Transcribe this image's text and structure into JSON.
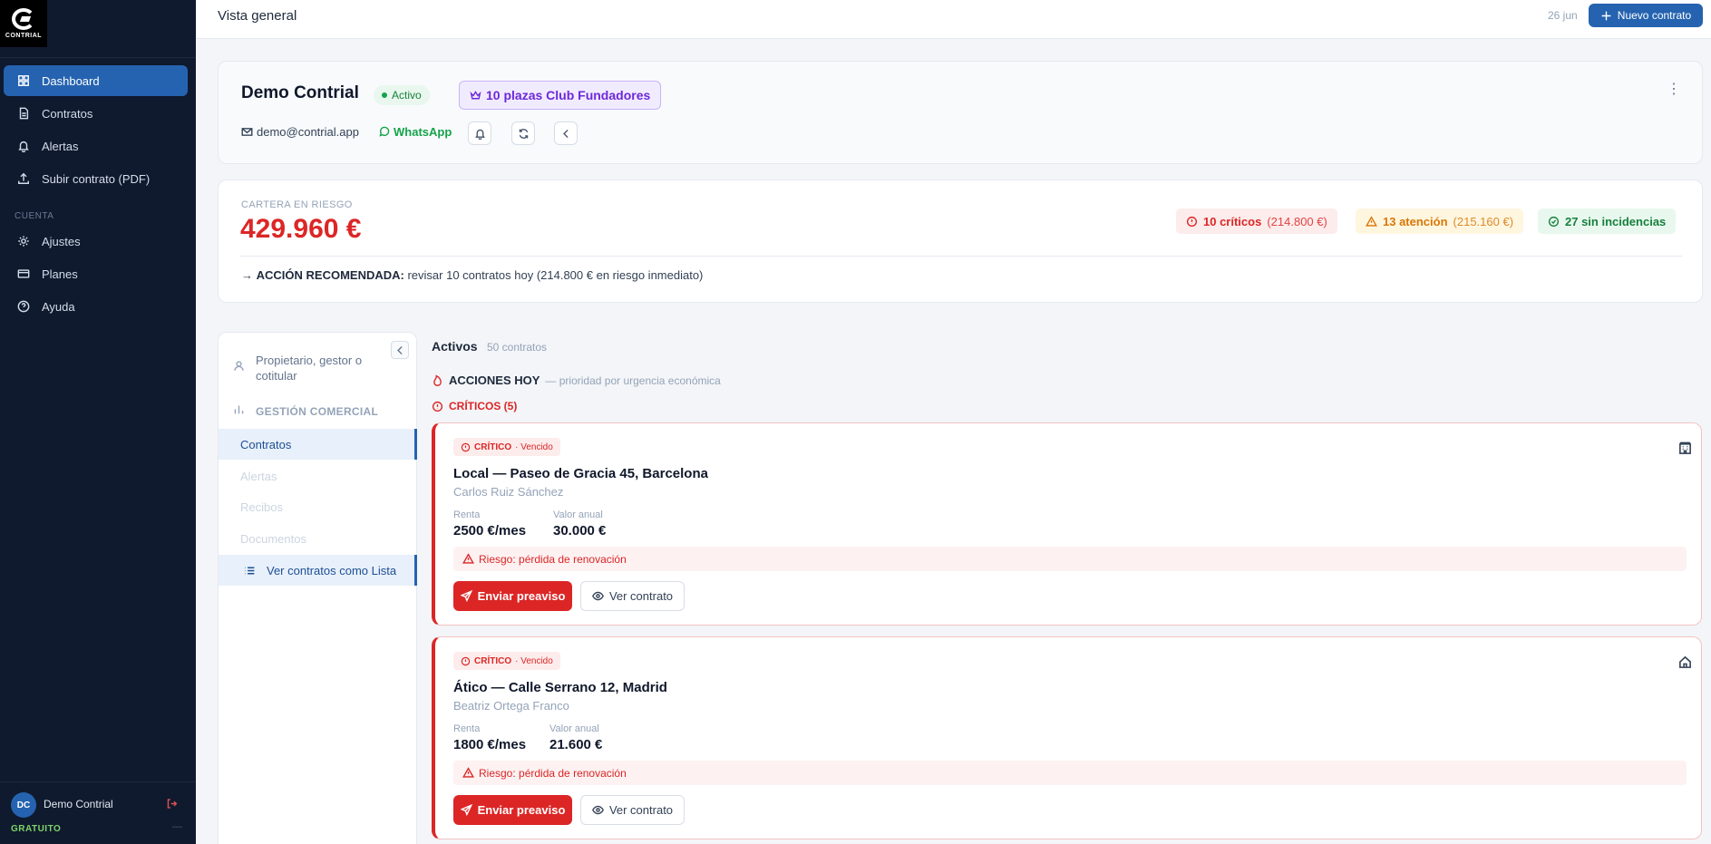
{
  "brand": {
    "logo_text": "CONTRIAL"
  },
  "sidebar": {
    "items": [
      {
        "label": "Dashboard",
        "icon": "grid-icon"
      },
      {
        "label": "Contratos",
        "icon": "document-icon"
      },
      {
        "label": "Alertas",
        "icon": "bell-icon"
      },
      {
        "label": "Subir contrato (PDF)",
        "icon": "upload-icon"
      }
    ],
    "section_label": "CUENTA",
    "account_items": [
      {
        "label": "Ajustes",
        "icon": "gear-icon"
      },
      {
        "label": "Planes",
        "icon": "card-icon"
      },
      {
        "label": "Ayuda",
        "icon": "help-icon"
      }
    ],
    "user": {
      "initials": "DC",
      "name": "Demo Contrial",
      "plan": "GRATUITO",
      "plan_suffix": "—"
    }
  },
  "topbar": {
    "title": "Vista general",
    "date": "26 jun",
    "new_button": "Nuevo contrato"
  },
  "profile": {
    "company": "Demo Contrial",
    "status": "Activo",
    "club": "10 plazas Club Fundadores",
    "email": "demo@contrial.app",
    "whatsapp": "WhatsApp"
  },
  "risk": {
    "label": "CARTERA EN RIESGO",
    "value": "429.960 €",
    "chips": {
      "critical": {
        "label": "10 críticos",
        "sub": "(214.800 €)"
      },
      "attention": {
        "label": "13 atención",
        "sub": "(215.160 €)"
      },
      "ok": {
        "label": "27 sin incidencias"
      }
    },
    "action_label": "ACCIÓN RECOMENDADA:",
    "action_text": "revisar 10 contratos hoy (214.800 € en riesgo inmediato)"
  },
  "left_panel": {
    "role": "Propietario, gestor o cotitular",
    "section": "GESTIÓN COMERCIAL",
    "items": [
      "Contratos",
      "Alertas",
      "Recibos",
      "Documentos"
    ],
    "list_view": "Ver contratos como Lista"
  },
  "main": {
    "heading": "Activos",
    "count": "50 contratos",
    "actions_title": "ACCIONES HOY",
    "actions_note": "— prioridad por urgencia económica",
    "critical_group": "CRÍTICOS (5)",
    "labels": {
      "rent": "Renta",
      "annual": "Valor anual",
      "send": "Enviar preaviso",
      "view": "Ver contrato"
    },
    "contracts": [
      {
        "tag": "CRÍTICO",
        "tag_suffix": "· Vencido",
        "title": "Local — Paseo de Gracia 45, Barcelona",
        "person": "Carlos Ruiz Sánchez",
        "rent": "2500 €/mes",
        "annual": "30.000 €",
        "risk": "Riesgo: pérdida de renovación",
        "icon": "building-icon"
      },
      {
        "tag": "CRÍTICO",
        "tag_suffix": "· Vencido",
        "title": "Ático — Calle Serrano 12, Madrid",
        "person": "Beatriz Ortega Franco",
        "rent": "1800 €/mes",
        "annual": "21.600 €",
        "risk": "Riesgo: pérdida de renovación",
        "icon": "home-icon"
      }
    ]
  },
  "colors": {
    "accent": "#2563b0",
    "critical": "#dc2626",
    "attention": "#d97706",
    "ok": "#16803d",
    "sidebar": "#0f1a2e"
  }
}
